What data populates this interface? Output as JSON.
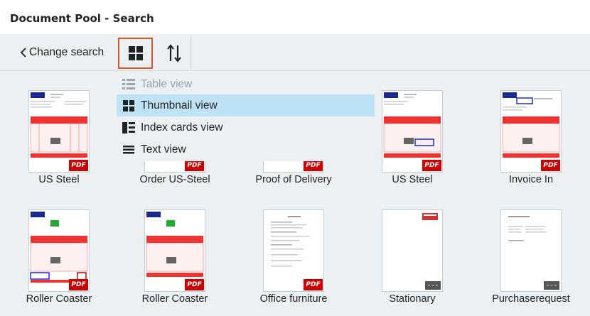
{
  "window": {
    "title": "Document Pool - Search"
  },
  "toolbar": {
    "back_label": "Change search",
    "accent_color": "#e0532a"
  },
  "view_menu": {
    "items": [
      {
        "label": "Table view",
        "icon": "table-view-icon",
        "state": "disabled"
      },
      {
        "label": "Thumbnail view",
        "icon": "thumbnail-view-icon",
        "state": "selected"
      },
      {
        "label": "Index cards view",
        "icon": "index-cards-icon",
        "state": "normal"
      },
      {
        "label": "Text view",
        "icon": "text-view-icon",
        "state": "normal"
      }
    ],
    "selected_color": "#bfe3f6"
  },
  "documents": [
    {
      "label": "US Steel",
      "badge": "PDF"
    },
    {
      "label": "Order US-Steel",
      "badge": "PDF"
    },
    {
      "label": "Proof of Delivery",
      "badge": "PDF"
    },
    {
      "label": "US Steel",
      "badge": "PDF"
    },
    {
      "label": "Invoice In",
      "badge": "PDF"
    },
    {
      "label": "Roller Coaster",
      "badge": "PDF"
    },
    {
      "label": "Roller Coaster",
      "badge": "PDF"
    },
    {
      "label": "Office furniture",
      "badge": "PDF"
    },
    {
      "label": "Stationary",
      "badge": ""
    },
    {
      "label": "Purchaserequest",
      "badge": ""
    }
  ]
}
